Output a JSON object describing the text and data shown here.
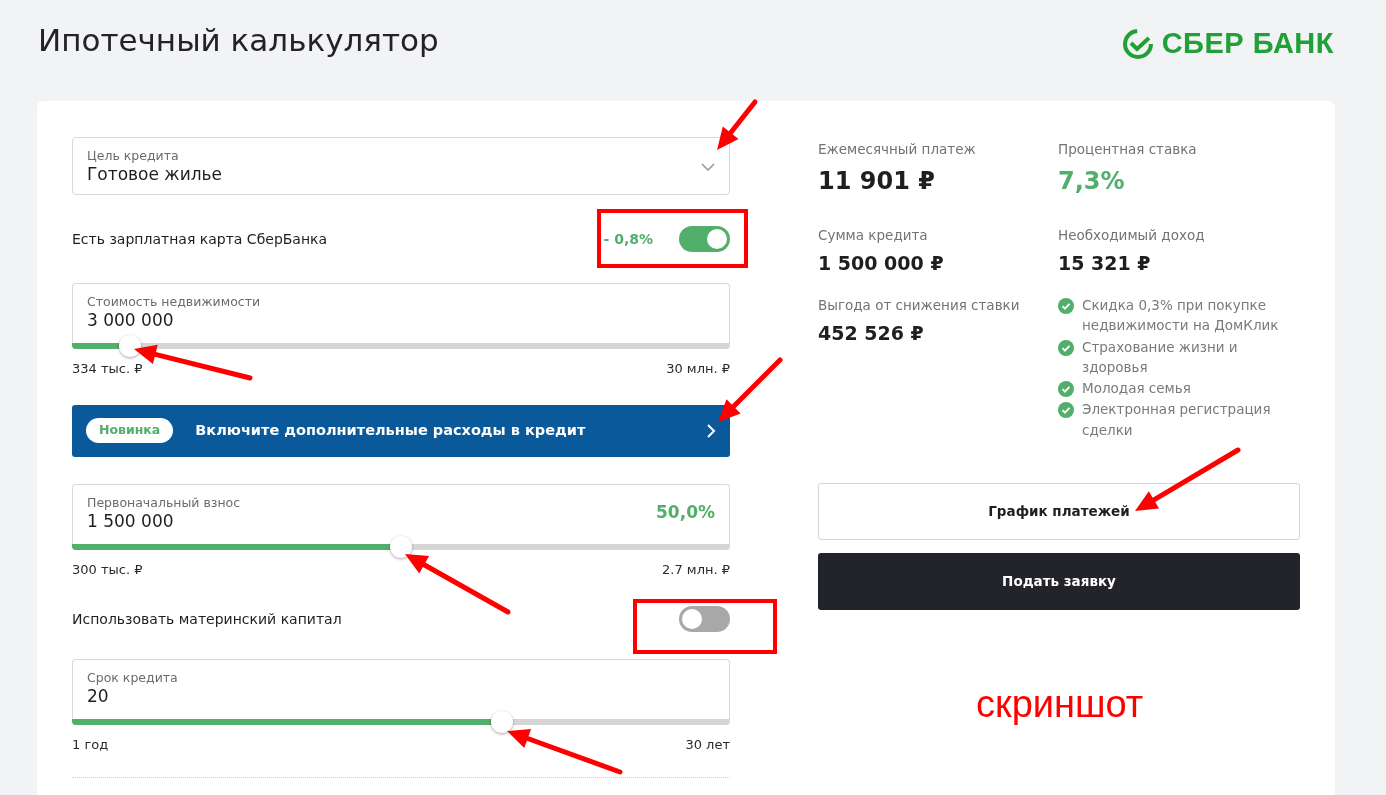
{
  "header": {
    "title": "Ипотечный калькулятор",
    "logo_text": "СБЕР БАНК"
  },
  "form": {
    "purpose": {
      "label": "Цель кредита",
      "value": "Готовое жилье"
    },
    "salary_card": {
      "label": "Есть зарплатная карта СберБанка",
      "discount": "- 0,8%",
      "on": true
    },
    "price": {
      "label": "Стоимость недвижимости",
      "value": "3 000 000",
      "level": 0.088,
      "min": "334 тыс. ₽",
      "max": "30 млн. ₽"
    },
    "banner": {
      "badge": "Новинка",
      "text": "Включите дополнительные расходы в кредит"
    },
    "down_payment": {
      "label": "Первоначальный взнос",
      "value": "1 500 000",
      "percent": "50,0%",
      "level": 0.5,
      "min": "300 тыс. ₽",
      "max": "2.7 млн. ₽"
    },
    "maternity_capital": {
      "label": "Использовать материнский капитал",
      "on": false
    },
    "term": {
      "label": "Срок кредита",
      "value": "20",
      "level": 0.653,
      "min": "1 год",
      "max": "30 лет"
    }
  },
  "results": [
    {
      "label": "Ежемесячный платеж",
      "value": "11 901 ₽",
      "highlight": false
    },
    {
      "label": "Процентная ставка",
      "value": "7,3%",
      "highlight": true
    },
    {
      "label": "Сумма кредита",
      "value": "1 500 000 ₽",
      "highlight": false
    },
    {
      "label": "Необходимый доход",
      "value": "15 321 ₽",
      "highlight": false
    },
    {
      "label": "Выгода от снижения ставки",
      "value": "452 526 ₽",
      "highlight": false
    }
  ],
  "benefits": [
    "Скидка 0,3% при покупке недвижимости на ДомКлик",
    "Страхование жизни и здоровья",
    "Молодая семья",
    "Электронная регистрация сделки"
  ],
  "buttons": [
    {
      "label": "График платежей",
      "kind": "outline"
    },
    {
      "label": "Подать заявку",
      "kind": "primary"
    }
  ],
  "annotation": {
    "text": "скриншот"
  }
}
